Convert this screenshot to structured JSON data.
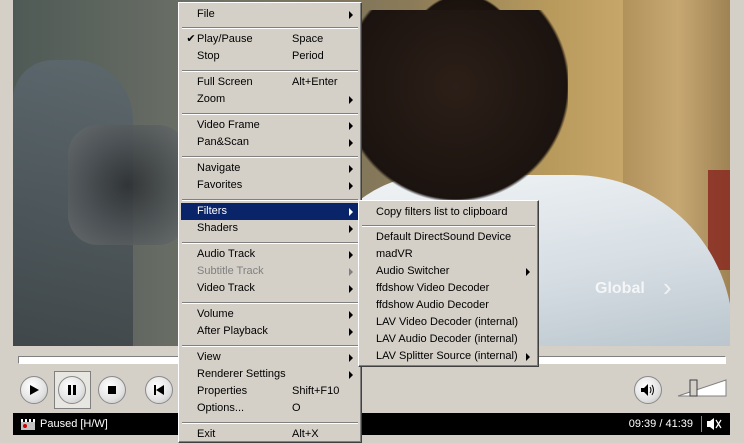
{
  "video": {
    "watermark": "Global"
  },
  "status": {
    "text": "Paused [H/W]",
    "time": "09:39 / 41:39"
  },
  "main_menu": {
    "items": [
      {
        "label": "File",
        "accel": "",
        "submenu": true,
        "checked": false,
        "disabled": false,
        "selected": false
      },
      {
        "label": "Play/Pause",
        "accel": "Space",
        "submenu": false,
        "checked": true,
        "disabled": false,
        "selected": false
      },
      {
        "label": "Stop",
        "accel": "Period",
        "submenu": false,
        "checked": false,
        "disabled": false,
        "selected": false
      },
      {
        "label": "Full Screen",
        "accel": "Alt+Enter",
        "submenu": false,
        "checked": false,
        "disabled": false,
        "selected": false
      },
      {
        "label": "Zoom",
        "accel": "",
        "submenu": true,
        "checked": false,
        "disabled": false,
        "selected": false
      },
      {
        "label": "Video Frame",
        "accel": "",
        "submenu": true,
        "checked": false,
        "disabled": false,
        "selected": false
      },
      {
        "label": "Pan&Scan",
        "accel": "",
        "submenu": true,
        "checked": false,
        "disabled": false,
        "selected": false
      },
      {
        "label": "Navigate",
        "accel": "",
        "submenu": true,
        "checked": false,
        "disabled": false,
        "selected": false
      },
      {
        "label": "Favorites",
        "accel": "",
        "submenu": true,
        "checked": false,
        "disabled": false,
        "selected": false
      },
      {
        "label": "Filters",
        "accel": "",
        "submenu": true,
        "checked": false,
        "disabled": false,
        "selected": true
      },
      {
        "label": "Shaders",
        "accel": "",
        "submenu": true,
        "checked": false,
        "disabled": false,
        "selected": false
      },
      {
        "label": "Audio Track",
        "accel": "",
        "submenu": true,
        "checked": false,
        "disabled": false,
        "selected": false
      },
      {
        "label": "Subtitle Track",
        "accel": "",
        "submenu": true,
        "checked": false,
        "disabled": true,
        "selected": false
      },
      {
        "label": "Video Track",
        "accel": "",
        "submenu": true,
        "checked": false,
        "disabled": false,
        "selected": false
      },
      {
        "label": "Volume",
        "accel": "",
        "submenu": true,
        "checked": false,
        "disabled": false,
        "selected": false
      },
      {
        "label": "After Playback",
        "accel": "",
        "submenu": true,
        "checked": false,
        "disabled": false,
        "selected": false
      },
      {
        "label": "View",
        "accel": "",
        "submenu": true,
        "checked": false,
        "disabled": false,
        "selected": false
      },
      {
        "label": "Renderer Settings",
        "accel": "",
        "submenu": true,
        "checked": false,
        "disabled": false,
        "selected": false
      },
      {
        "label": "Properties",
        "accel": "Shift+F10",
        "submenu": false,
        "checked": false,
        "disabled": false,
        "selected": false
      },
      {
        "label": "Options...",
        "accel": "O",
        "submenu": false,
        "checked": false,
        "disabled": false,
        "selected": false
      },
      {
        "label": "Exit",
        "accel": "Alt+X",
        "submenu": false,
        "checked": false,
        "disabled": false,
        "selected": false
      }
    ]
  },
  "filters_menu": {
    "items": [
      {
        "label": "Copy filters list to clipboard",
        "submenu": false
      },
      {
        "label": "Default DirectSound Device",
        "submenu": false
      },
      {
        "label": "madVR",
        "submenu": false
      },
      {
        "label": "Audio Switcher",
        "submenu": true
      },
      {
        "label": "ffdshow Video Decoder",
        "submenu": false
      },
      {
        "label": "ffdshow Audio Decoder",
        "submenu": false
      },
      {
        "label": "LAV Video Decoder (internal)",
        "submenu": false
      },
      {
        "label": "LAV Audio Decoder (internal)",
        "submenu": false
      },
      {
        "label": "LAV Splitter Source (internal)",
        "submenu": true
      }
    ]
  },
  "icons": {
    "play": "play-icon",
    "pause": "pause-icon",
    "stop": "stop-icon",
    "previous": "skip-previous-icon",
    "mute": "speaker-icon",
    "status": "film-clapper-icon",
    "audio": "audio-output-icon"
  },
  "volume": {
    "level": 0.35
  }
}
